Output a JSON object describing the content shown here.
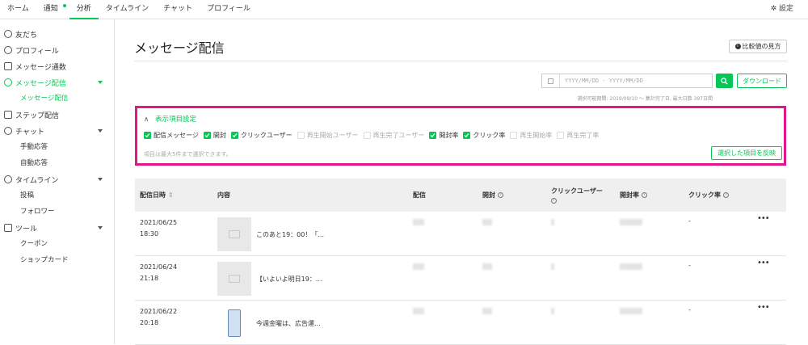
{
  "topnav": {
    "tabs": [
      {
        "label": "ホーム"
      },
      {
        "label": "通知"
      },
      {
        "label": "分析"
      },
      {
        "label": "タイムライン"
      },
      {
        "label": "チャット"
      },
      {
        "label": "プロフィール"
      }
    ],
    "active_tab": "分析",
    "settings_label": "設定"
  },
  "sidebar": {
    "items": [
      {
        "label": "友だち"
      },
      {
        "label": "プロフィール"
      },
      {
        "label": "メッセージ通数"
      },
      {
        "label": "メッセージ配信"
      },
      {
        "label": "メッセージ配信"
      },
      {
        "label": "ステップ配信"
      },
      {
        "label": "チャット"
      },
      {
        "label": "手動応答"
      },
      {
        "label": "自動応答"
      },
      {
        "label": "タイムライン"
      },
      {
        "label": "投稿"
      },
      {
        "label": "フォロワー"
      },
      {
        "label": "ツール"
      },
      {
        "label": "クーポン"
      },
      {
        "label": "ショップカード"
      }
    ]
  },
  "main": {
    "title": "メッセージ配信",
    "compare_label": "比較値の見方",
    "date_placeholder": "YYYY/MM/DD - YYYY/MM/DD",
    "download_label": "ダウンロード",
    "period_note": "選択可能期間: 2019/09/10 〜 集計完了日, 最大日数 397日間"
  },
  "panel": {
    "title": "表示項目設定",
    "options": [
      {
        "label": "配信メッセージ",
        "checked": true
      },
      {
        "label": "開封",
        "checked": true
      },
      {
        "label": "クリックユーザー",
        "checked": true
      },
      {
        "label": "再生開始ユーザー",
        "checked": false
      },
      {
        "label": "再生完了ユーザー",
        "checked": false
      },
      {
        "label": "開封率",
        "checked": true
      },
      {
        "label": "クリック率",
        "checked": true
      },
      {
        "label": "再生開始率",
        "checked": false
      },
      {
        "label": "再生完了率",
        "checked": false
      }
    ],
    "note": "項目は最大5件まで選択できます。",
    "apply_label": "選択した項目を反映"
  },
  "table": {
    "headers": {
      "date": "配信日時",
      "content": "内容",
      "delivered": "配信",
      "opened": "開封",
      "click_users": "クリックユーザー",
      "open_rate": "開封率",
      "click_rate": "クリック率"
    },
    "rows": [
      {
        "date": "2021/06/25",
        "time": "18:30",
        "content": "このあと19：00！「...",
        "click_rate": "-"
      },
      {
        "date": "2021/06/24",
        "time": "21:18",
        "content": "【いよいよ明日19：...",
        "click_rate": "-"
      },
      {
        "date": "2021/06/22",
        "time": "20:18",
        "content": "今週金曜は、広告運...",
        "click_rate": "-"
      }
    ]
  },
  "colors": {
    "accent": "#06c755",
    "highlight_border": "#e0168b"
  }
}
